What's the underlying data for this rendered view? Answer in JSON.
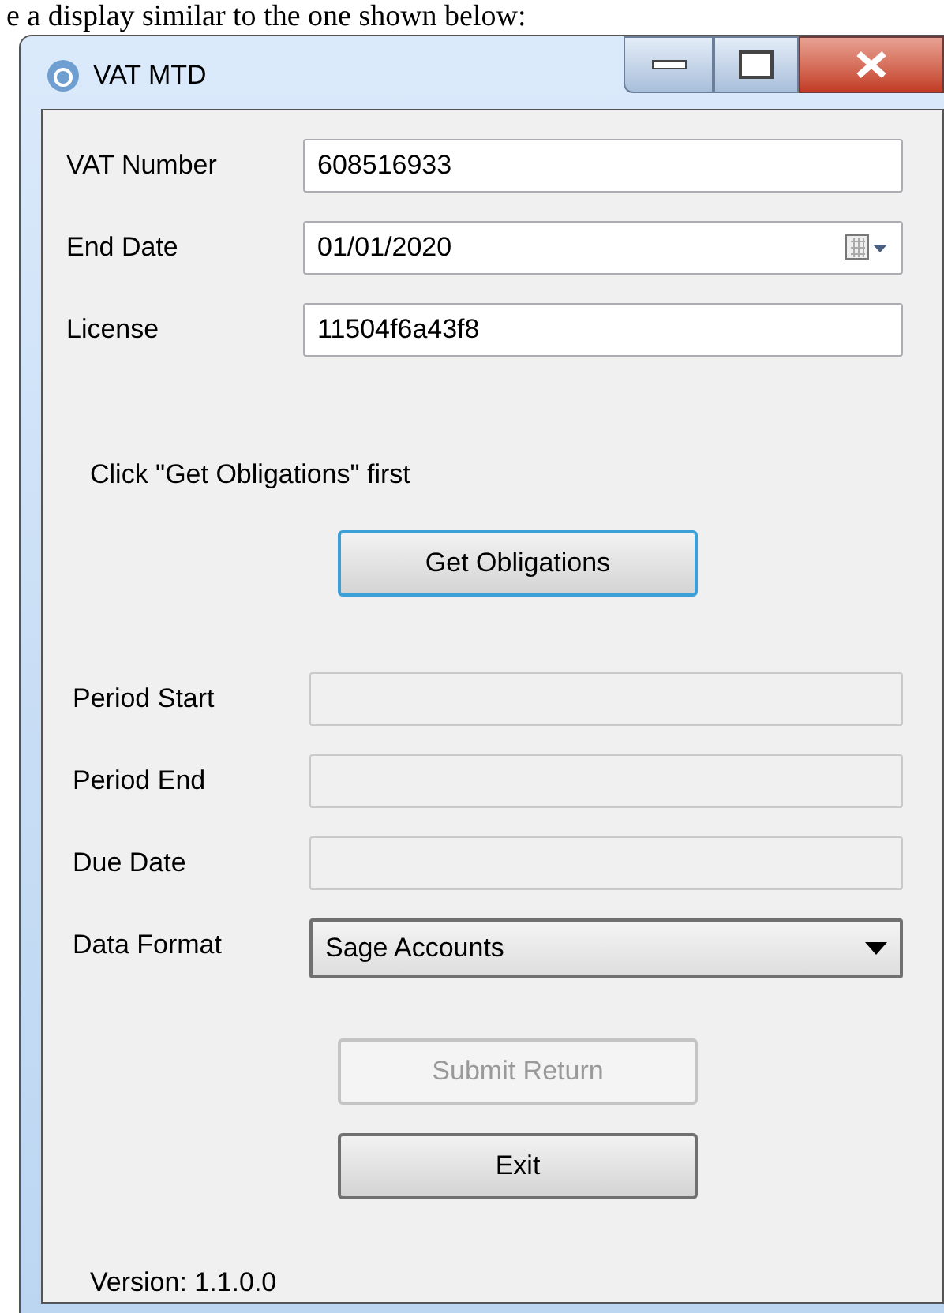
{
  "document_text": "e a display similar to the one shown below:",
  "window": {
    "title": "VAT MTD"
  },
  "top_fields": [
    {
      "kind": "text",
      "label": "VAT Number",
      "value": "608516933"
    },
    {
      "kind": "date",
      "label": "End Date",
      "value": "01/01/2020"
    },
    {
      "kind": "text",
      "label": "License",
      "value": "11504f6a43f8"
    }
  ],
  "hint": "Click \"Get Obligations\" first",
  "obligations_button": {
    "label": "Get Obligations",
    "focused": true,
    "disabled": false
  },
  "bottom_fields": [
    {
      "kind": "text",
      "label": "Period Start",
      "disabled": true
    },
    {
      "kind": "text",
      "label": "Period End",
      "disabled": true
    },
    {
      "kind": "text",
      "label": "Due Date",
      "disabled": true
    },
    {
      "kind": "select",
      "label": "Data Format",
      "value": "Sage Accounts"
    }
  ],
  "buttons": [
    {
      "label": "Submit Return",
      "disabled": true
    },
    {
      "label": "Exit",
      "disabled": false
    }
  ],
  "version": "Version: 1.1.0.0"
}
